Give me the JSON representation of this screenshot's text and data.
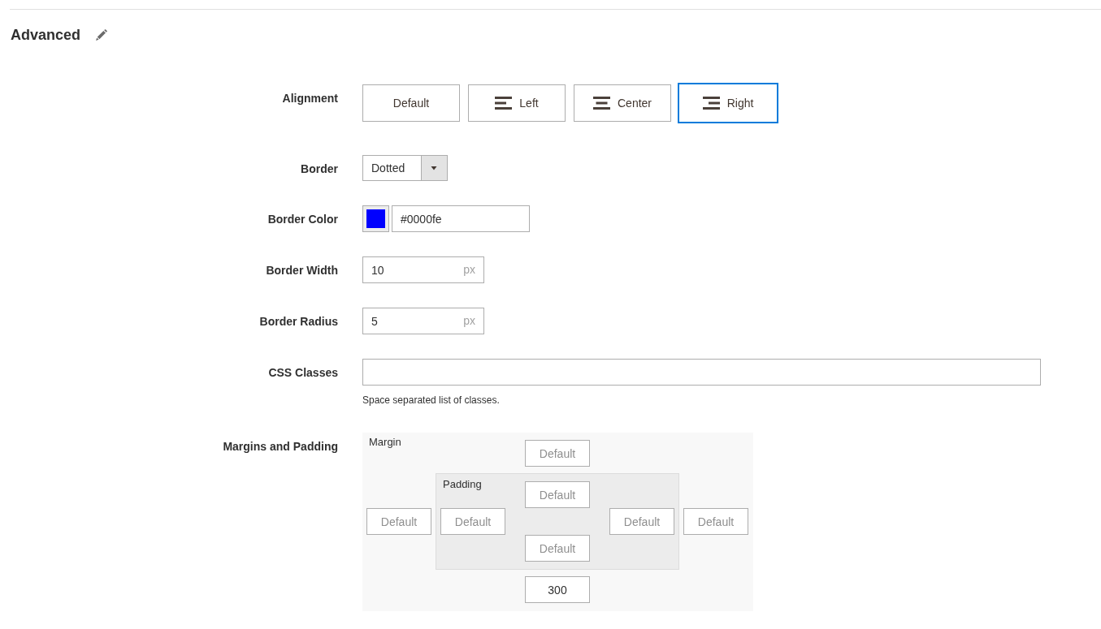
{
  "section": {
    "title": "Advanced"
  },
  "fields": [
    {
      "kind": "alignment",
      "label": "Alignment",
      "options": [
        {
          "kind": "text",
          "label": "Default",
          "selected": false
        },
        {
          "kind": "align-left",
          "label": "Left",
          "selected": false
        },
        {
          "kind": "align-center",
          "label": "Center",
          "selected": false
        },
        {
          "kind": "align-right",
          "label": "Right",
          "selected": true
        }
      ]
    },
    {
      "kind": "select",
      "label": "Border",
      "value": "Dotted"
    },
    {
      "kind": "color",
      "label": "Border Color",
      "color": "#0000fe",
      "value": "#0000fe"
    },
    {
      "kind": "unit",
      "label": "Border Width",
      "value": "10",
      "unit": "px"
    },
    {
      "kind": "unit",
      "label": "Border Radius",
      "value": "5",
      "unit": "px"
    },
    {
      "kind": "text",
      "label": "CSS Classes",
      "note": "Space separated list of classes."
    },
    {
      "kind": "spacing",
      "label": "Margins and Padding",
      "margin": {
        "title": "Margin",
        "top": {
          "placeholder": "Default"
        },
        "right": {
          "placeholder": "Default"
        },
        "bottom": {
          "value": "300"
        },
        "left": {
          "placeholder": "Default"
        }
      },
      "padding": {
        "title": "Padding",
        "top": {
          "placeholder": "Default"
        },
        "right": {
          "placeholder": "Default"
        },
        "bottom": {
          "placeholder": "Default"
        },
        "left": {
          "placeholder": "Default"
        }
      }
    }
  ]
}
